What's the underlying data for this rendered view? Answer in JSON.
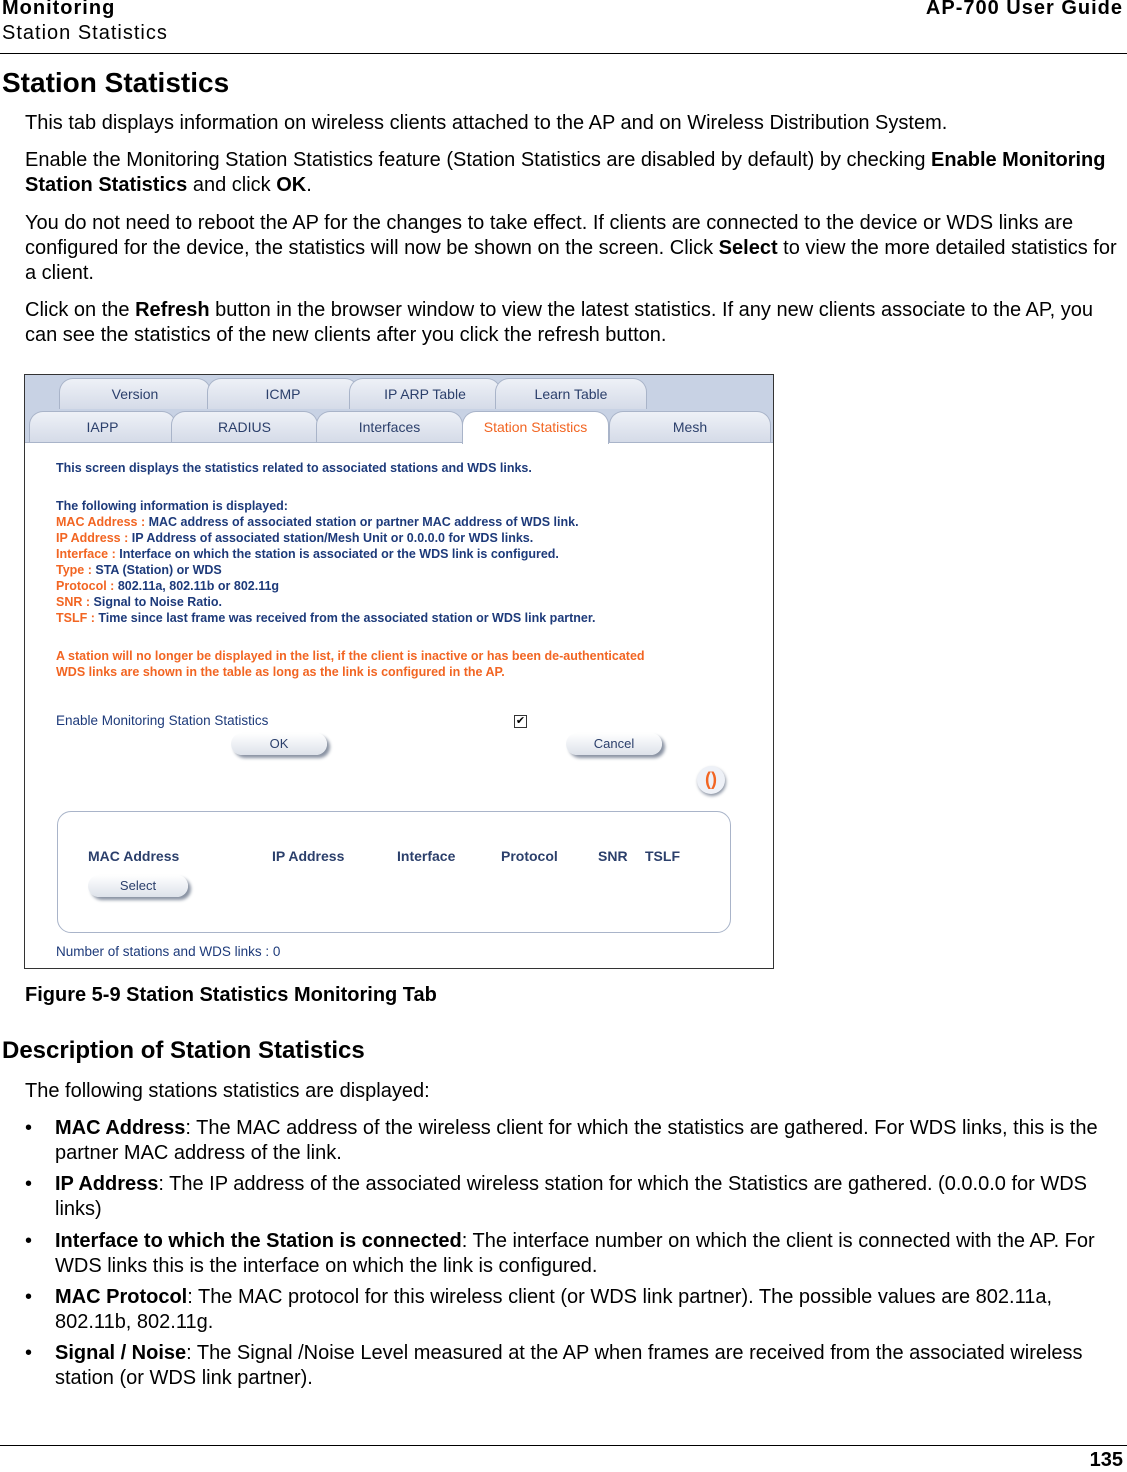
{
  "header": {
    "section": "Monitoring",
    "subsection": "Station Statistics",
    "guide": "AP-700 User Guide"
  },
  "title": "Station Statistics",
  "intro": [
    {
      "parts": [
        {
          "t": "This tab displays information on wireless clients attached to the AP and on Wireless Distribution System."
        }
      ]
    },
    {
      "parts": [
        {
          "t": "Enable the Monitoring Station Statistics feature (Station Statistics are disabled by default) by checking "
        },
        {
          "t": "Enable Monitoring Station Statistics",
          "b": true
        },
        {
          "t": " and click "
        },
        {
          "t": "OK",
          "b": true
        },
        {
          "t": "."
        }
      ]
    },
    {
      "parts": [
        {
          "t": "You do not need to reboot the AP for the changes to take effect. If clients are connected to the device or WDS links are configured for the device, the statistics will now be shown on the screen. Click "
        },
        {
          "t": "Select",
          "b": true
        },
        {
          "t": " to view the more detailed statistics for a client."
        }
      ]
    },
    {
      "parts": [
        {
          "t": "Click on the "
        },
        {
          "t": "Refresh",
          "b": true
        },
        {
          "t": " button in the browser window to view the latest statistics. If any new clients associate to the AP, you can see the statistics of the new clients after you click the refresh button."
        }
      ]
    }
  ],
  "screenshot": {
    "tabs_row1": [
      "Version",
      "ICMP",
      "IP ARP Table",
      "Learn Table"
    ],
    "tabs_row2": [
      "IAPP",
      "RADIUS",
      "Interfaces",
      "Station Statistics",
      "Mesh"
    ],
    "active_tab": "Station Statistics",
    "desc": "This screen displays the statistics related to associated stations and WDS links.",
    "info_heading": "The following information is displayed:",
    "info": [
      {
        "k": "MAC Address :",
        "v": " MAC address of associated station or partner MAC address of WDS link."
      },
      {
        "k": "IP Address :",
        "v": " IP Address of associated station/Mesh Unit or 0.0.0.0 for WDS links."
      },
      {
        "k": "Interface :",
        "v": " Interface on which the station is associated or the WDS link is configured."
      },
      {
        "k": "Type :",
        "v": " STA (Station) or WDS"
      },
      {
        "k": "Protocol :",
        "v": " 802.11a, 802.11b or 802.11g"
      },
      {
        "k": "SNR :",
        "v": " Signal to Noise Ratio."
      },
      {
        "k": "TSLF :",
        "v": " Time since last frame was received from the associated station or WDS link partner."
      }
    ],
    "warn1": "A station will no longer be displayed in the list, if the client is inactive or has been de-authenticated",
    "warn2": "WDS links are shown in the table as long as the link is configured in the AP.",
    "enable_label": "Enable Monitoring Station Statistics",
    "enable_checked": true,
    "ok": "OK",
    "cancel": "Cancel",
    "columns": [
      "MAC Address",
      "IP Address",
      "Interface",
      "Protocol",
      "SNR",
      "TSLF"
    ],
    "select": "Select",
    "count": "Number of stations and WDS links : 0",
    "colors": {
      "navy": "#1d3a7a",
      "orange": "#f26522"
    }
  },
  "caption": "Figure 5-9 Station Statistics Monitoring Tab",
  "desc_title": "Description of Station Statistics",
  "desc_intro": "The following stations statistics are displayed:",
  "bullets": [
    {
      "k": "MAC Address",
      "v": ": The MAC address of the wireless client for which the statistics are gathered. For WDS links, this is the partner MAC address of the link."
    },
    {
      "k": "IP Address",
      "v": ": The IP address of the associated wireless station for which the Statistics are gathered. (0.0.0.0 for WDS links)"
    },
    {
      "k": "Interface to which the Station is connected",
      "v": ": The interface number on which the client is connected with the AP. For WDS links this is the interface on which the link is configured."
    },
    {
      "k": "MAC Protocol",
      "v": ": The MAC protocol for this wireless client (or WDS link partner). The possible values are 802.11a, 802.11b, 802.11g."
    },
    {
      "k": "Signal / Noise",
      "v": ": The Signal /Noise Level measured at the AP when frames are received from the associated wireless station (or WDS link partner)."
    }
  ],
  "bullet_char": "•",
  "page_number": "135"
}
